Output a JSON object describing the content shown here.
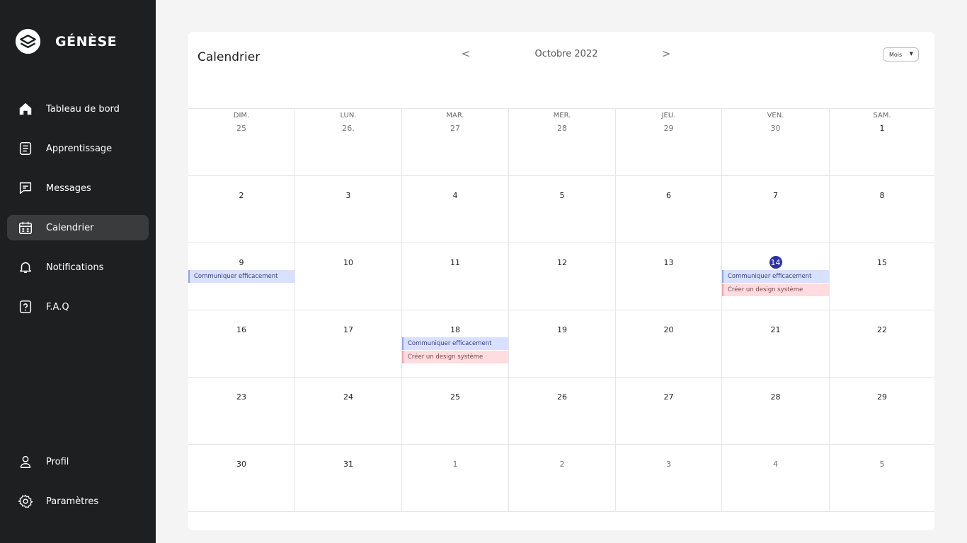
{
  "brand": {
    "name": "GÉNÈSE"
  },
  "sidebar": {
    "items": [
      {
        "label": "Tableau de bord",
        "icon": "home-icon",
        "active": false
      },
      {
        "label": "Apprentissage",
        "icon": "book-icon",
        "active": false
      },
      {
        "label": "Messages",
        "icon": "message-icon",
        "active": false
      },
      {
        "label": "Calendrier",
        "icon": "calendar-icon",
        "active": true
      },
      {
        "label": "Notifications",
        "icon": "bell-icon",
        "active": false
      },
      {
        "label": "F.A.Q",
        "icon": "help-icon",
        "active": false
      }
    ],
    "bottom_items": [
      {
        "label": "Profil",
        "icon": "user-icon"
      },
      {
        "label": "Paramètres",
        "icon": "gear-icon"
      }
    ]
  },
  "calendar": {
    "title": "Calendrier",
    "month": "Octobre 2022",
    "prev_label": "<",
    "next_label": ">",
    "view": "Mois",
    "weekdays": [
      "DIM.",
      "LUN.",
      "MAR.",
      "MER.",
      "JEU.",
      "VEN.",
      "SAM."
    ],
    "weeks": [
      [
        {
          "d": "25",
          "m": true
        },
        {
          "d": "26.",
          "m": true
        },
        {
          "d": "27",
          "m": true
        },
        {
          "d": "28",
          "m": true
        },
        {
          "d": "29",
          "m": true
        },
        {
          "d": "30",
          "m": true
        },
        {
          "d": "1"
        }
      ],
      [
        {
          "d": "2"
        },
        {
          "d": "3"
        },
        {
          "d": "4"
        },
        {
          "d": "5"
        },
        {
          "d": "6"
        },
        {
          "d": "7"
        },
        {
          "d": "8"
        }
      ],
      [
        {
          "d": "9",
          "events": [
            {
              "t": "Communiquer efficacement",
              "c": "blue"
            }
          ]
        },
        {
          "d": "10"
        },
        {
          "d": "11"
        },
        {
          "d": "12"
        },
        {
          "d": "13"
        },
        {
          "d": "14",
          "today": true,
          "events": [
            {
              "t": "Communiquer efficacement",
              "c": "blue"
            },
            {
              "t": "Créer un design système",
              "c": "red"
            }
          ]
        },
        {
          "d": "15"
        }
      ],
      [
        {
          "d": "16"
        },
        {
          "d": "17"
        },
        {
          "d": "18",
          "events": [
            {
              "t": "Communiquer efficacement",
              "c": "blue"
            },
            {
              "t": "Créer un design système",
              "c": "red"
            }
          ]
        },
        {
          "d": "19"
        },
        {
          "d": "20"
        },
        {
          "d": "21"
        },
        {
          "d": "22"
        }
      ],
      [
        {
          "d": "23"
        },
        {
          "d": "24"
        },
        {
          "d": "25"
        },
        {
          "d": "26"
        },
        {
          "d": "27"
        },
        {
          "d": "28"
        },
        {
          "d": "29"
        }
      ],
      [
        {
          "d": "30"
        },
        {
          "d": "31"
        },
        {
          "d": "1",
          "m": true
        },
        {
          "d": "2",
          "m": true
        },
        {
          "d": "3",
          "m": true
        },
        {
          "d": "4",
          "m": true
        },
        {
          "d": "5",
          "m": true
        }
      ]
    ]
  },
  "colors": {
    "sidebar": "#1e1f20",
    "accent": "#2d31a6",
    "event_blue": "#d8e1ff",
    "event_red": "#ffdcdf"
  }
}
